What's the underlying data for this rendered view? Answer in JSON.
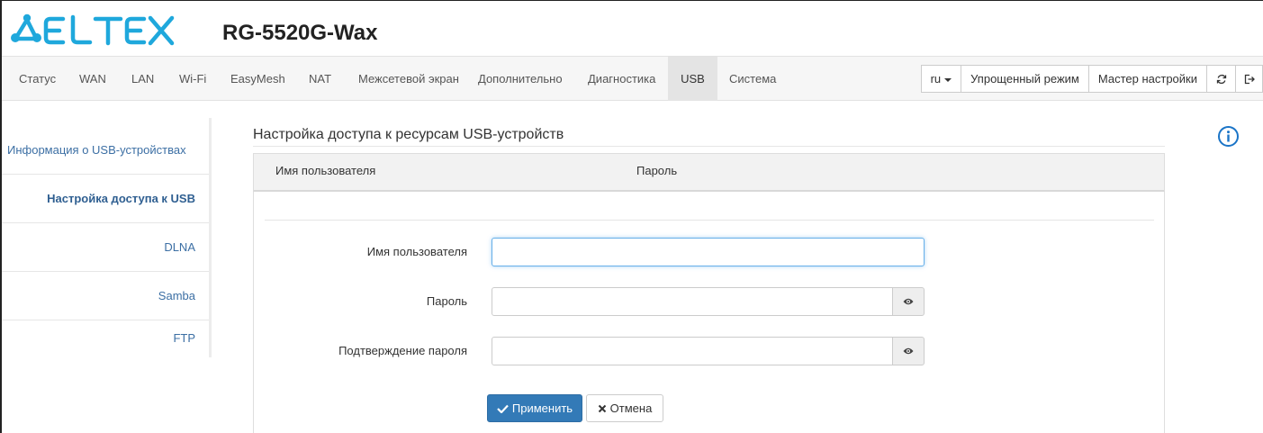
{
  "brand": {
    "logo_text": "ELTEX",
    "device": "RG-5520G-Wax",
    "accent": "#1fa8dc"
  },
  "nav": {
    "items": [
      {
        "label": "Статус"
      },
      {
        "label": "WAN"
      },
      {
        "label": "LAN"
      },
      {
        "label": "Wi-Fi"
      },
      {
        "label": "EasyMesh"
      },
      {
        "label": "NAT"
      },
      {
        "label": "Межсетевой экран"
      },
      {
        "label": "Дополнительно"
      },
      {
        "label": "Диагностика"
      },
      {
        "label": "USB",
        "active": true
      },
      {
        "label": "Система"
      }
    ],
    "lang": "ru",
    "simple_mode": "Упрощенный режим",
    "wizard": "Мастер настройки",
    "refresh_icon": "refresh-icon",
    "logout_icon": "logout-icon"
  },
  "sidebar": {
    "items": [
      {
        "label": "Информация о USB-устройствах"
      },
      {
        "label": "Настройка доступа к USB",
        "active": true
      },
      {
        "label": "DLNA"
      },
      {
        "label": "Samba"
      },
      {
        "label": "FTP"
      }
    ]
  },
  "content": {
    "title": "Настройка доступа к ресурсам USB-устройств",
    "table": {
      "columns": [
        "Имя пользователя",
        "Пароль"
      ]
    },
    "form": {
      "username_label": "Имя пользователя",
      "username_value": "",
      "password_label": "Пароль",
      "password_value": "",
      "confirm_label": "Подтверждение пароля",
      "confirm_value": ""
    },
    "apply": "Применить",
    "cancel": "Отмена"
  },
  "colors": {
    "primary": "#337ab7",
    "link": "#3c6fa4",
    "info": "#1a74c7"
  }
}
